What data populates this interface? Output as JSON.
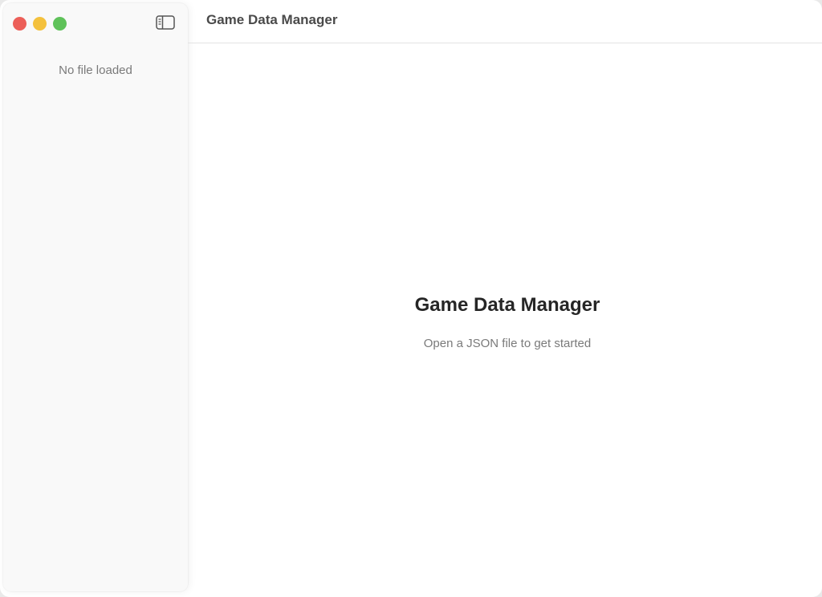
{
  "window": {
    "title": "Game Data Manager",
    "controls": {
      "close_color": "#ec5f59",
      "minimize_color": "#f4c13d",
      "zoom_color": "#5fc25a"
    }
  },
  "sidebar": {
    "toggle_icon": "sidebar-left-icon",
    "status": "No file loaded"
  },
  "main": {
    "empty_state": {
      "title": "Game Data Manager",
      "subtitle": "Open a JSON file to get started"
    }
  }
}
